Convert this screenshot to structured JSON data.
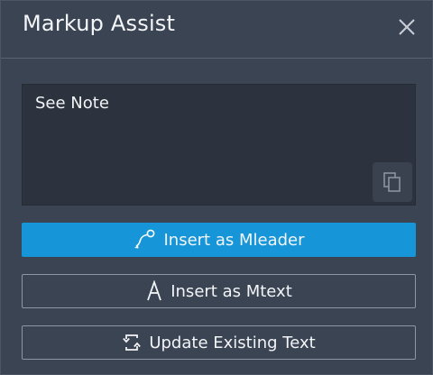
{
  "window": {
    "title": "Markup Assist"
  },
  "note": {
    "text": "See Note"
  },
  "buttons": {
    "mleader": "Insert as Mleader",
    "mtext": "Insert as Mtext",
    "update": "Update Existing Text"
  },
  "icons": {
    "close": "close-icon",
    "copy": "copy-icon",
    "mleader": "mleader-icon",
    "mtext": "text-a-icon",
    "update": "refresh-icon"
  },
  "colors": {
    "panel_bg": "#3b4453",
    "note_bg": "#2c333e",
    "accent": "#1696d8",
    "outline": "#8d96a6"
  }
}
